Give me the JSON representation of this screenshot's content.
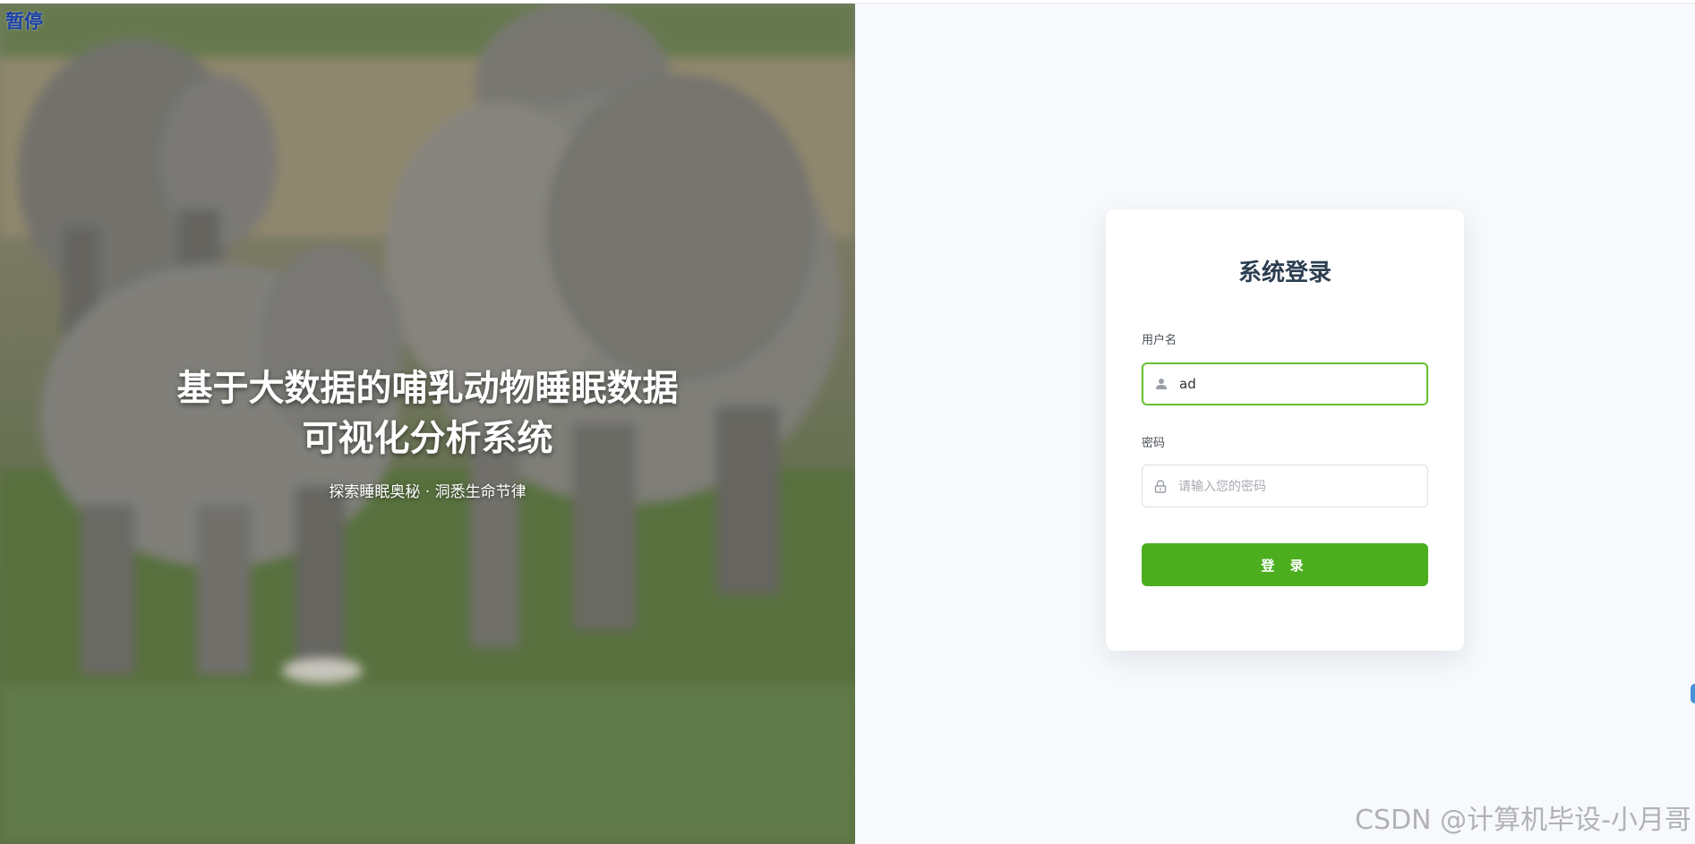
{
  "video_overlay": {
    "pause_label": "暂停"
  },
  "hero": {
    "title_line1": "基于大数据的哺乳动物睡眠数据",
    "title_line2": "可视化分析系统",
    "subtitle": "探索睡眠奥秘 · 洞悉生命节律"
  },
  "login": {
    "title": "系统登录",
    "username_label": "用户名",
    "username_value": "ad",
    "password_label": "密码",
    "password_placeholder": "请输入您的密码",
    "submit_label": "登 录"
  },
  "watermark": "CSDN @计算机毕设-小月哥",
  "colors": {
    "accent": "#4cae1e",
    "focus_border": "#67c23a",
    "title": "#2c3e50",
    "page_bg": "#f7f9fc"
  },
  "icons": {
    "username": "user-icon",
    "password": "lock-icon"
  }
}
